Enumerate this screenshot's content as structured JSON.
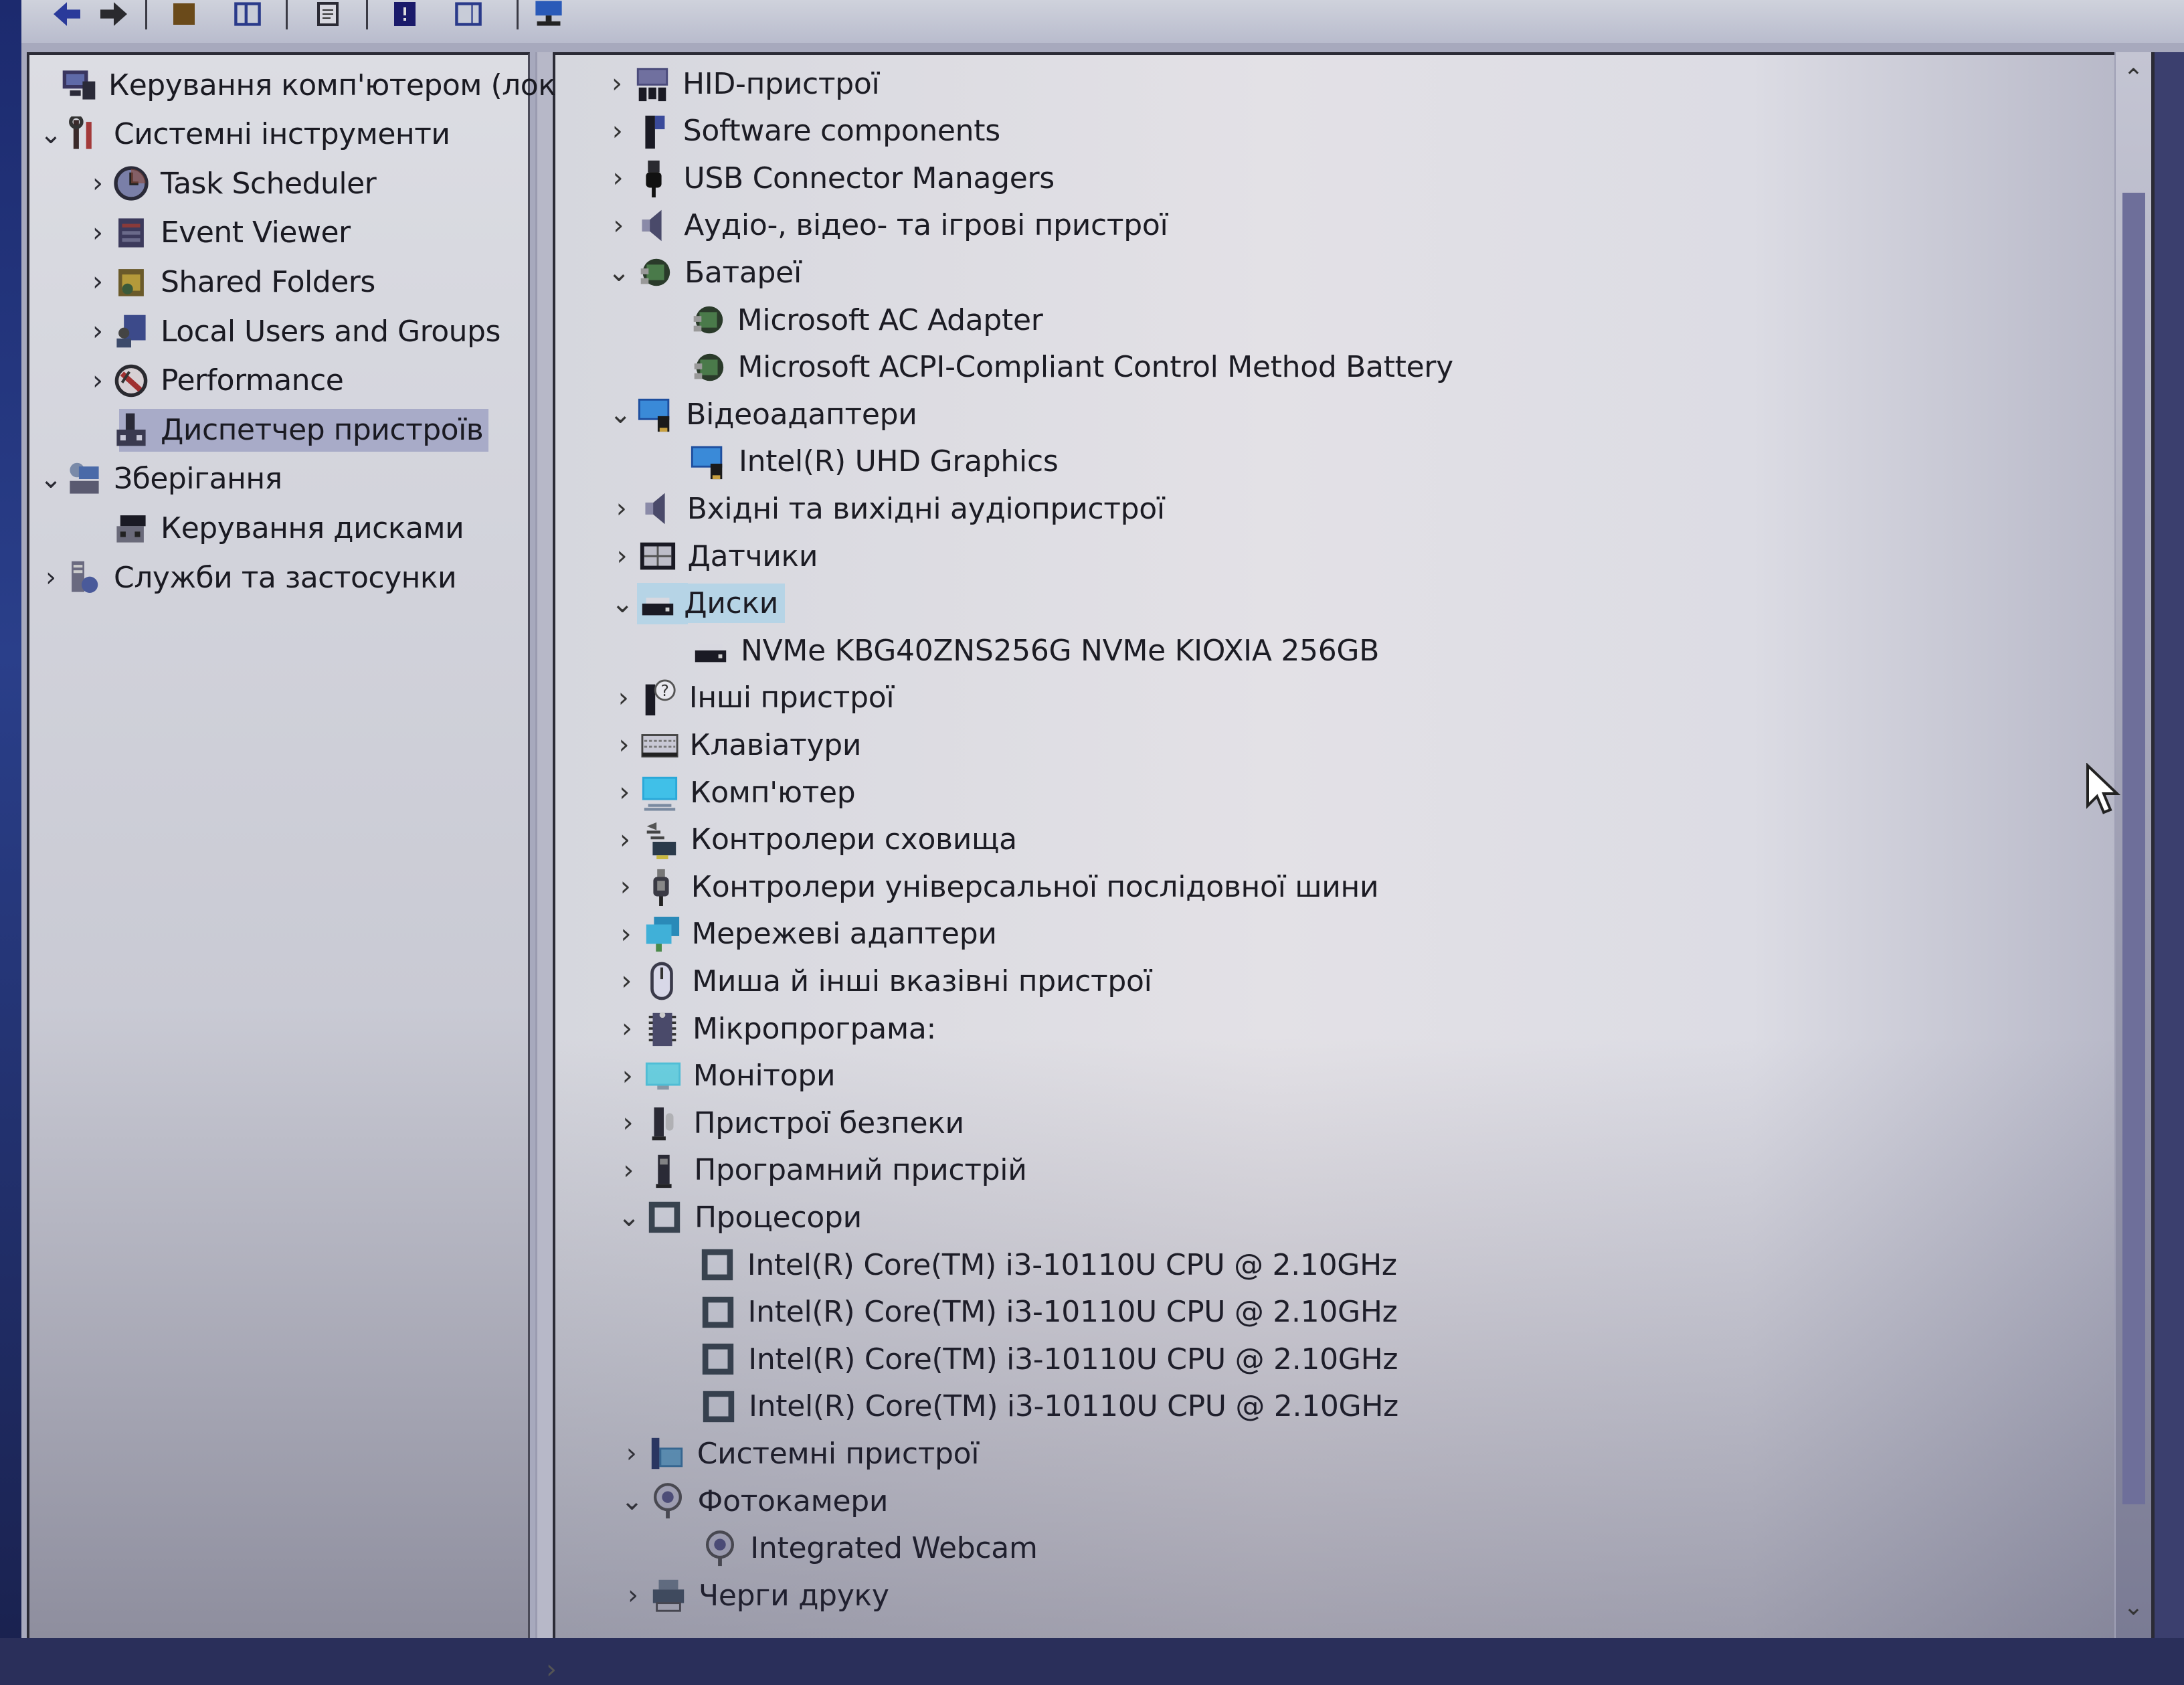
{
  "window": {
    "toolbar": [
      {
        "name": "back-icon"
      },
      {
        "name": "forward-icon"
      },
      {
        "name": "up-folder-icon"
      },
      {
        "name": "show-hide-tree-icon"
      },
      {
        "name": "properties-icon"
      },
      {
        "name": "help-icon"
      },
      {
        "name": "show-action-pane-icon"
      },
      {
        "name": "scan-hardware-icon"
      }
    ]
  },
  "left_tree": {
    "items": [
      {
        "label": "Керування комп'ютером (лок",
        "icon": "computer-management-icon",
        "level": 0,
        "expander": ""
      },
      {
        "label": "Системні інструменти",
        "icon": "system-tools-icon",
        "level": 0,
        "expander": "expanded"
      },
      {
        "label": "Task Scheduler",
        "icon": "task-scheduler-icon",
        "level": 1,
        "expander": "collapsed"
      },
      {
        "label": "Event Viewer",
        "icon": "event-viewer-icon",
        "level": 1,
        "expander": "collapsed"
      },
      {
        "label": "Shared Folders",
        "icon": "shared-folders-icon",
        "level": 1,
        "expander": "collapsed"
      },
      {
        "label": "Local Users and Groups",
        "icon": "local-users-icon",
        "level": 1,
        "expander": "collapsed"
      },
      {
        "label": "Performance",
        "icon": "performance-icon",
        "level": 1,
        "expander": "collapsed"
      },
      {
        "label": "Диспетчер пристроїв",
        "icon": "device-manager-icon",
        "level": 1,
        "expander": "",
        "selected": true
      },
      {
        "label": "Зберігання",
        "icon": "storage-icon",
        "level": 0,
        "expander": "expanded"
      },
      {
        "label": "Керування дисками",
        "icon": "disk-management-icon",
        "level": 1,
        "expander": ""
      },
      {
        "label": "Служби та застосунки",
        "icon": "services-apps-icon",
        "level": 0,
        "expander": "collapsed"
      }
    ]
  },
  "device_tree": {
    "items": [
      {
        "label": "HID-пристрої",
        "icon": "hid-icon",
        "level": 0,
        "expander": "collapsed"
      },
      {
        "label": "Software components",
        "icon": "software-components-icon",
        "level": 0,
        "expander": "collapsed"
      },
      {
        "label": "USB Connector Managers",
        "icon": "usb-connector-icon",
        "level": 0,
        "expander": "collapsed"
      },
      {
        "label": "Аудіо-, відео- та ігрові пристрої",
        "icon": "speaker-icon",
        "level": 0,
        "expander": "collapsed"
      },
      {
        "label": "Батареї",
        "icon": "battery-icon",
        "level": 0,
        "expander": "expanded"
      },
      {
        "label": "Microsoft AC Adapter",
        "icon": "battery-icon",
        "level": 1,
        "expander": ""
      },
      {
        "label": "Microsoft ACPI-Compliant Control Method Battery",
        "icon": "battery-icon",
        "level": 1,
        "expander": ""
      },
      {
        "label": "Відеоадаптери",
        "icon": "display-adapter-icon",
        "level": 0,
        "expander": "expanded"
      },
      {
        "label": "Intel(R) UHD Graphics",
        "icon": "display-adapter-icon",
        "level": 1,
        "expander": ""
      },
      {
        "label": "Вхідні та вихідні аудіопристрої",
        "icon": "speaker-icon",
        "level": 0,
        "expander": "collapsed"
      },
      {
        "label": "Датчики",
        "icon": "sensor-icon",
        "level": 0,
        "expander": "collapsed"
      },
      {
        "label": "Диски",
        "icon": "disk-drive-icon",
        "level": 0,
        "expander": "expanded",
        "highlight": true
      },
      {
        "label": "NVMe KBG40ZNS256G NVMe KIOXIA 256GB",
        "icon": "disk-drive-icon",
        "level": 1,
        "expander": ""
      },
      {
        "label": "Інші пристрої",
        "icon": "other-devices-icon",
        "level": 0,
        "expander": "collapsed"
      },
      {
        "label": "Клавіатури",
        "icon": "keyboard-icon",
        "level": 0,
        "expander": "collapsed"
      },
      {
        "label": "Комп'ютер",
        "icon": "computer-icon",
        "level": 0,
        "expander": "collapsed"
      },
      {
        "label": "Контролери сховища",
        "icon": "storage-controller-icon",
        "level": 0,
        "expander": "collapsed"
      },
      {
        "label": "Контролери універсальної послідовної шини",
        "icon": "usb-controller-icon",
        "level": 0,
        "expander": "collapsed"
      },
      {
        "label": "Мережеві адаптери",
        "icon": "network-adapter-icon",
        "level": 0,
        "expander": "collapsed"
      },
      {
        "label": "Миша й інші вказівні пристрої",
        "icon": "mouse-icon",
        "level": 0,
        "expander": "collapsed"
      },
      {
        "label": "Мікропрограма:",
        "icon": "firmware-icon",
        "level": 0,
        "expander": "collapsed"
      },
      {
        "label": "Монітори",
        "icon": "monitor-icon",
        "level": 0,
        "expander": "collapsed"
      },
      {
        "label": "Пристрої безпеки",
        "icon": "security-device-icon",
        "level": 0,
        "expander": "collapsed"
      },
      {
        "label": "Програмний пристрій",
        "icon": "software-device-icon",
        "level": 0,
        "expander": "collapsed"
      },
      {
        "label": "Процесори",
        "icon": "processor-icon",
        "level": 0,
        "expander": "expanded"
      },
      {
        "label": "Intel(R) Core(TM) i3-10110U CPU @ 2.10GHz",
        "icon": "processor-icon",
        "level": 1,
        "expander": ""
      },
      {
        "label": "Intel(R) Core(TM) i3-10110U CPU @ 2.10GHz",
        "icon": "processor-icon",
        "level": 1,
        "expander": ""
      },
      {
        "label": "Intel(R) Core(TM) i3-10110U CPU @ 2.10GHz",
        "icon": "processor-icon",
        "level": 1,
        "expander": ""
      },
      {
        "label": "Intel(R) Core(TM) i3-10110U CPU @ 2.10GHz",
        "icon": "processor-icon",
        "level": 1,
        "expander": ""
      },
      {
        "label": "Системні пристрої",
        "icon": "system-devices-icon",
        "level": 0,
        "expander": "collapsed"
      },
      {
        "label": "Фотокамери",
        "icon": "camera-icon",
        "level": 0,
        "expander": "expanded"
      },
      {
        "label": "Integrated Webcam",
        "icon": "camera-icon",
        "level": 1,
        "expander": ""
      },
      {
        "label": "Черги друку",
        "icon": "print-queue-icon",
        "level": 0,
        "expander": "collapsed"
      }
    ]
  },
  "glyphs": {
    "collapsed": "›",
    "expanded": "⌄",
    "scroll_up": "⌃",
    "scroll_down": "⌄",
    "scroll_right": "›"
  }
}
